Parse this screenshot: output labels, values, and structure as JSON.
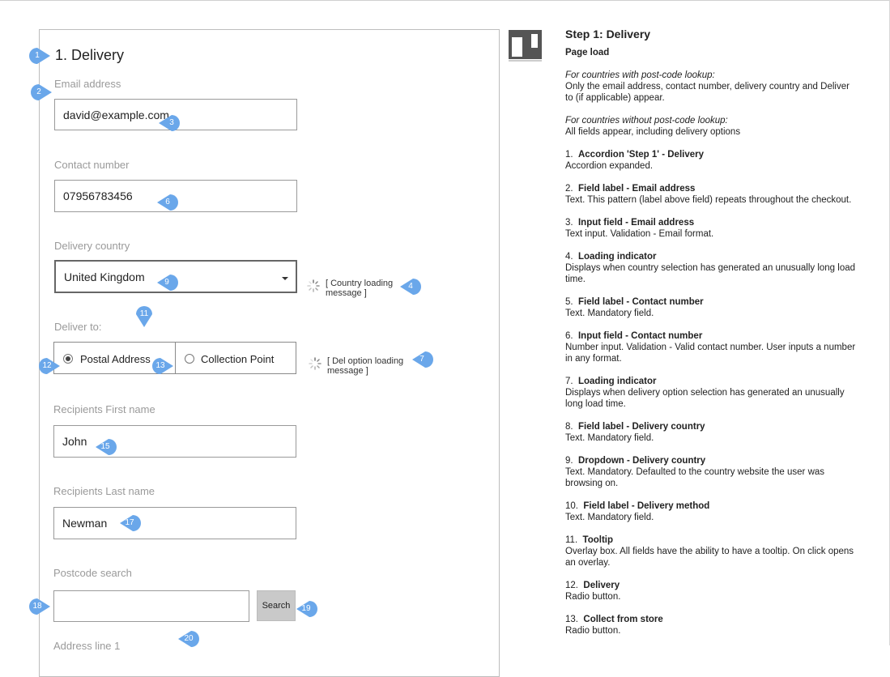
{
  "form": {
    "heading": "1. Delivery",
    "email": {
      "label": "Email address",
      "value": "david@example.com"
    },
    "contact": {
      "label": "Contact number",
      "value": "07956783456"
    },
    "country": {
      "label": "Delivery country",
      "value": "United Kingdom",
      "loading_message": "[ Country loading message ]"
    },
    "deliver_to": {
      "label": "Deliver to:",
      "options": [
        {
          "label": "Postal Address",
          "selected": true
        },
        {
          "label": "Collection Point",
          "selected": false
        }
      ],
      "loading_message": "[ Del option loading message ]"
    },
    "first_name": {
      "label": "Recipients First name",
      "value": "John"
    },
    "last_name": {
      "label": "Recipients Last name",
      "value": "Newman"
    },
    "postcode": {
      "label": "Postcode search",
      "value": "",
      "button": "Search"
    },
    "address_line1": {
      "label": "Address line 1"
    }
  },
  "markers": [
    "1",
    "2",
    "3",
    "4",
    "6",
    "7",
    "9",
    "11",
    "12",
    "13",
    "15",
    "17",
    "18",
    "19",
    "20"
  ],
  "marker_color": "#6aa7ea",
  "notes": {
    "title": "Step 1: Delivery",
    "subtitle": "Page load",
    "p1_italic": "For countries with post-code lookup:",
    "p1_text": "Only the email address, contact number, delivery country and Deliver to (if applicable) appear.",
    "p2_italic": "For countries without post-code lookup:",
    "p2_text": "All fields appear, including delivery options",
    "items": [
      {
        "num": "1.",
        "title": "Accordion 'Step 1' - Delivery",
        "text": "Accordion expanded."
      },
      {
        "num": "2.",
        "title": "Field label - Email address",
        "text": "Text. This pattern (label above field) repeats throughout the checkout."
      },
      {
        "num": "3.",
        "title": "Input field - Email address",
        "text": "Text input. Validation - Email format."
      },
      {
        "num": "4.",
        "title": "Loading indicator",
        "text": "Displays when country selection has generated an unusually long load time."
      },
      {
        "num": "5.",
        "title": "Field label - Contact number",
        "text": "Text. Mandatory field."
      },
      {
        "num": "6.",
        "title": "Input field - Contact number",
        "text": "Number input. Validation - Valid contact number. User inputs a number in any format."
      },
      {
        "num": "7.",
        "title": "Loading indicator",
        "text": "Displays when delivery option selection has generated an unusually long load time."
      },
      {
        "num": "8.",
        "title": "Field label - Delivery country",
        "text": "Text. Mandatory field."
      },
      {
        "num": "9.",
        "title": "Dropdown - Delivery country",
        "text": "Text. Mandatory. Defaulted to the country website the user was browsing on."
      },
      {
        "num": "10.",
        "title": "Field label - Delivery method",
        "text": "Text. Mandatory field."
      },
      {
        "num": "11.",
        "title": "Tooltip",
        "text": "Overlay box. All fields have the ability to have a tooltip. On click opens an overlay."
      },
      {
        "num": "12.",
        "title": "Delivery",
        "text": "Radio button."
      },
      {
        "num": "13.",
        "title": "Collect from store",
        "text": "Radio button."
      }
    ]
  }
}
